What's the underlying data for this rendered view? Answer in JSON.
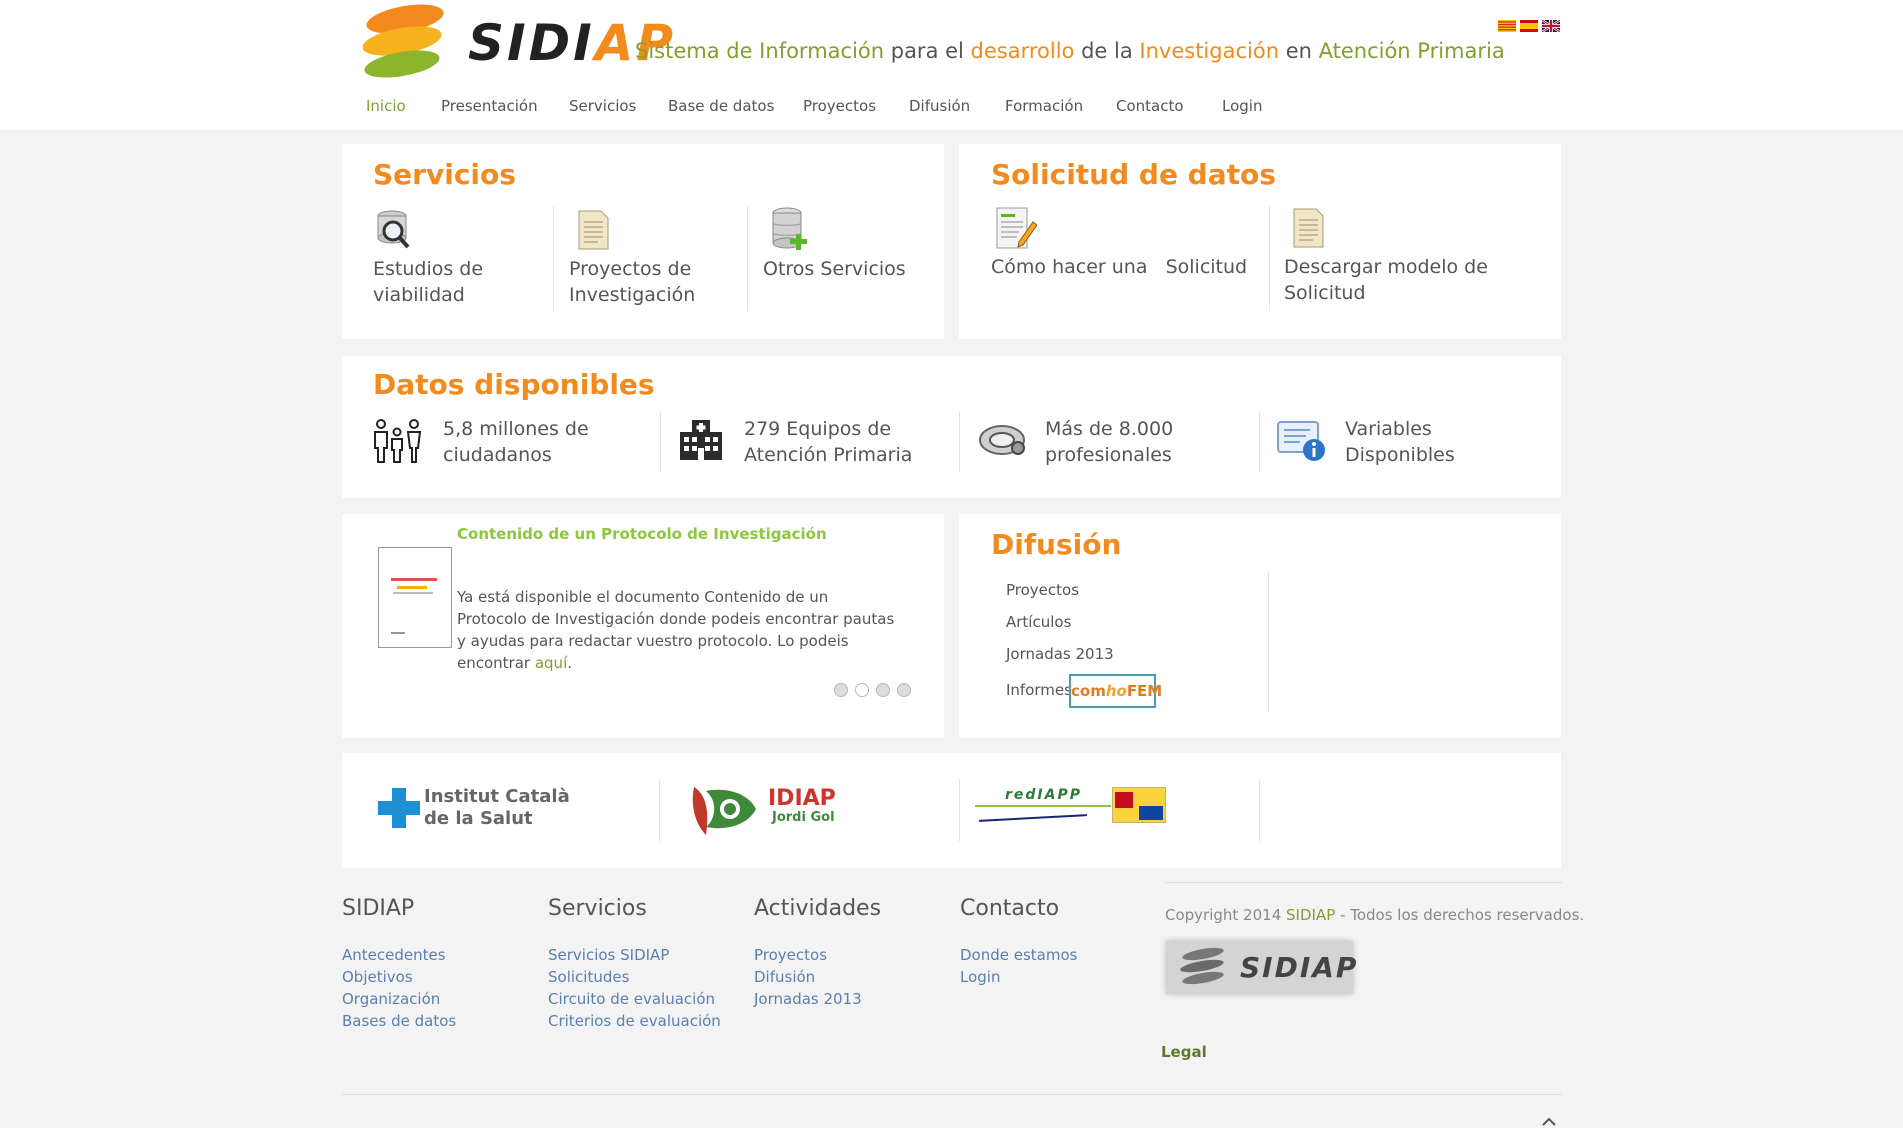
{
  "header": {
    "brand_main": "SIDI",
    "brand_accent": "AP",
    "tagline": {
      "p1": "Sistema de Información",
      "p2": " para el ",
      "p3": "desarrollo",
      "p4": " de la ",
      "p5": "Investigación",
      "p6": " en ",
      "p7": "Atención Primaria"
    },
    "languages": [
      "ca",
      "es",
      "en"
    ]
  },
  "nav": [
    {
      "label": "Inicio",
      "active": true
    },
    {
      "label": "Presentación"
    },
    {
      "label": "Servicios"
    },
    {
      "label": "Base de datos"
    },
    {
      "label": "Proyectos"
    },
    {
      "label": "Difusión"
    },
    {
      "label": "Formación"
    },
    {
      "label": "Contacto"
    },
    {
      "label": "Login"
    }
  ],
  "servicios": {
    "title": "Servicios",
    "items": [
      {
        "label": "Estudios de viabilidad",
        "icon": "magnifier-database-icon"
      },
      {
        "label": "Proyectos de Investigación",
        "icon": "document-icon"
      },
      {
        "label": "Otros Servicios",
        "icon": "database-add-icon"
      }
    ]
  },
  "solicitud": {
    "title": "Solicitud de datos",
    "items": [
      {
        "label": "Cómo hacer una   Solicitud",
        "icon": "form-edit-icon"
      },
      {
        "label": "Descargar modelo de Solicitud",
        "icon": "document-icon"
      }
    ]
  },
  "datos": {
    "title": "Datos disponibles",
    "items": [
      {
        "label": "5,8 millones de ciudadanos",
        "icon": "people-icon"
      },
      {
        "label": "279 Equipos de Atención Primaria",
        "icon": "hospital-icon"
      },
      {
        "label": "Más de 8.000 profesionales",
        "icon": "stethoscope-icon"
      },
      {
        "label": "Variables Disponibles",
        "icon": "info-card-icon"
      }
    ]
  },
  "news": {
    "title": "Contenido de un Protocolo de Investigación",
    "body": "Ya está disponible el documento Contenido de un Protocolo de Investigación donde podeis encontrar pautas y ayudas para redactar vuestro protocolo. Lo podeis encontrar ",
    "link": "aquí",
    "after_link": ".",
    "slide_count": 4,
    "active_slide": 2
  },
  "difusion": {
    "title": "Difusión",
    "links": [
      "Proyectos",
      "Artículos",
      "Jornadas 2013",
      "Informes"
    ],
    "badge": {
      "part1": "com",
      "part2": "ho",
      "part3": "FEM"
    }
  },
  "partners": {
    "ics_line1": "Institut Català",
    "ics_line2": "de la Salut",
    "idiap_line1": "IDIAP",
    "idiap_line2": "Jordi Gol",
    "redIAPP": "redIAPP"
  },
  "footer": {
    "columns": [
      {
        "heading": "SIDIAP",
        "links": [
          "Antecedentes",
          "Objetivos",
          "Organización",
          "Bases de datos"
        ]
      },
      {
        "heading": "Servicios",
        "links": [
          "Servicios SIDIAP",
          "Solicitudes",
          "Circuito de evaluación",
          "Criterios de evaluación"
        ]
      },
      {
        "heading": "Actividades",
        "links": [
          "Proyectos",
          "Difusión",
          "Jornadas 2013"
        ]
      },
      {
        "heading": "Contacto",
        "links": [
          "Donde estamos",
          "Login"
        ]
      }
    ],
    "copyright_pre": "Copyright 2014 ",
    "copyright_brand": "SIDIAP",
    "copyright_post": " - Todos los derechos reservados.",
    "logo_text": "SIDIAP",
    "legal": "Legal"
  },
  "colors": {
    "orange": "#f28a1e",
    "green": "#7fa12e",
    "link_blue": "#5a7fb0"
  }
}
